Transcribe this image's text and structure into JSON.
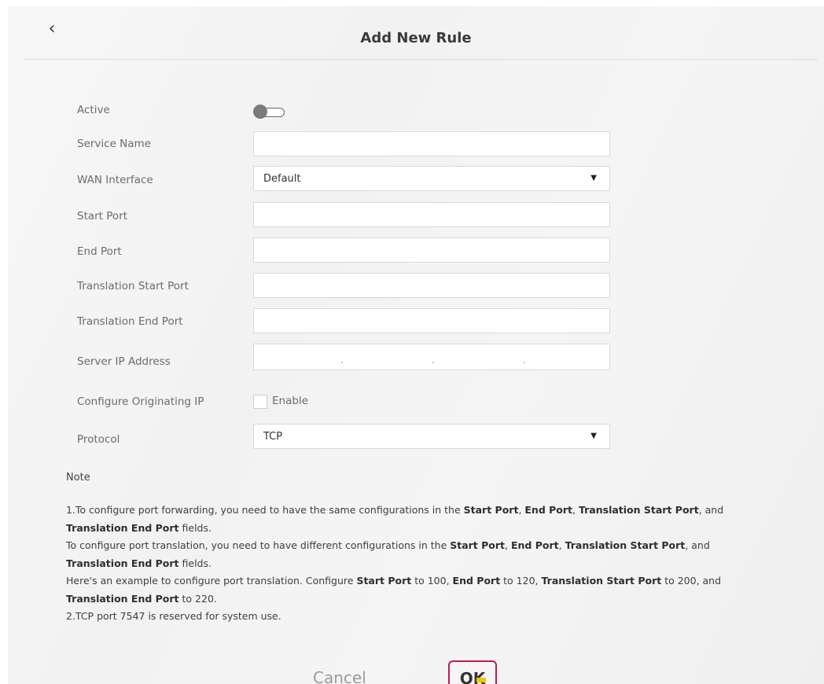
{
  "header": {
    "back_icon": "chevron-left-icon",
    "back_symbol": "‹",
    "title": "Add New Rule"
  },
  "form": {
    "active": {
      "label": "Active",
      "on": false
    },
    "service_name": {
      "label": "Service Name",
      "value": ""
    },
    "wan_interface": {
      "label": "WAN Interface",
      "value": "Default"
    },
    "start_port": {
      "label": "Start Port",
      "value": ""
    },
    "end_port": {
      "label": "End Port",
      "value": ""
    },
    "translation_start_port": {
      "label": "Translation Start Port",
      "value": ""
    },
    "translation_end_port": {
      "label": "Translation End Port",
      "value": ""
    },
    "server_ip": {
      "label": "Server IP Address",
      "separator": "."
    },
    "originating_ip": {
      "label": "Configure Originating IP",
      "checkbox_label": "Enable",
      "checked": false
    },
    "protocol": {
      "label": "Protocol",
      "value": "TCP"
    },
    "caret_symbol": "▼"
  },
  "note": {
    "title": "Note",
    "l1": [
      "1.To configure port forwarding, you need to have the same configurations in the ",
      "Start Port",
      ", ",
      "End Port",
      ", ",
      "Translation Start Port",
      ", and"
    ],
    "l2": [
      "Translation End Port",
      " fields."
    ],
    "l3": [
      "To configure port translation, you need to have different configurations in the ",
      "Start Port",
      ", ",
      "End Port",
      ", ",
      "Translation Start Port",
      ", and"
    ],
    "l4": [
      "Translation End Port",
      " fields."
    ],
    "l5": [
      "Here's an example to configure port translation. Configure ",
      "Start Port",
      " to 100, ",
      "End Port",
      " to 120, ",
      "Translation Start Port",
      " to 200, and"
    ],
    "l6": [
      "Translation End Port",
      " to 220."
    ],
    "l7": "2.TCP port 7547 is reserved for system use."
  },
  "buttons": {
    "cancel": "Cancel",
    "ok": "OK"
  },
  "colors": {
    "ok_border": "#c2185b",
    "ok_highlight": "#f0c400"
  }
}
